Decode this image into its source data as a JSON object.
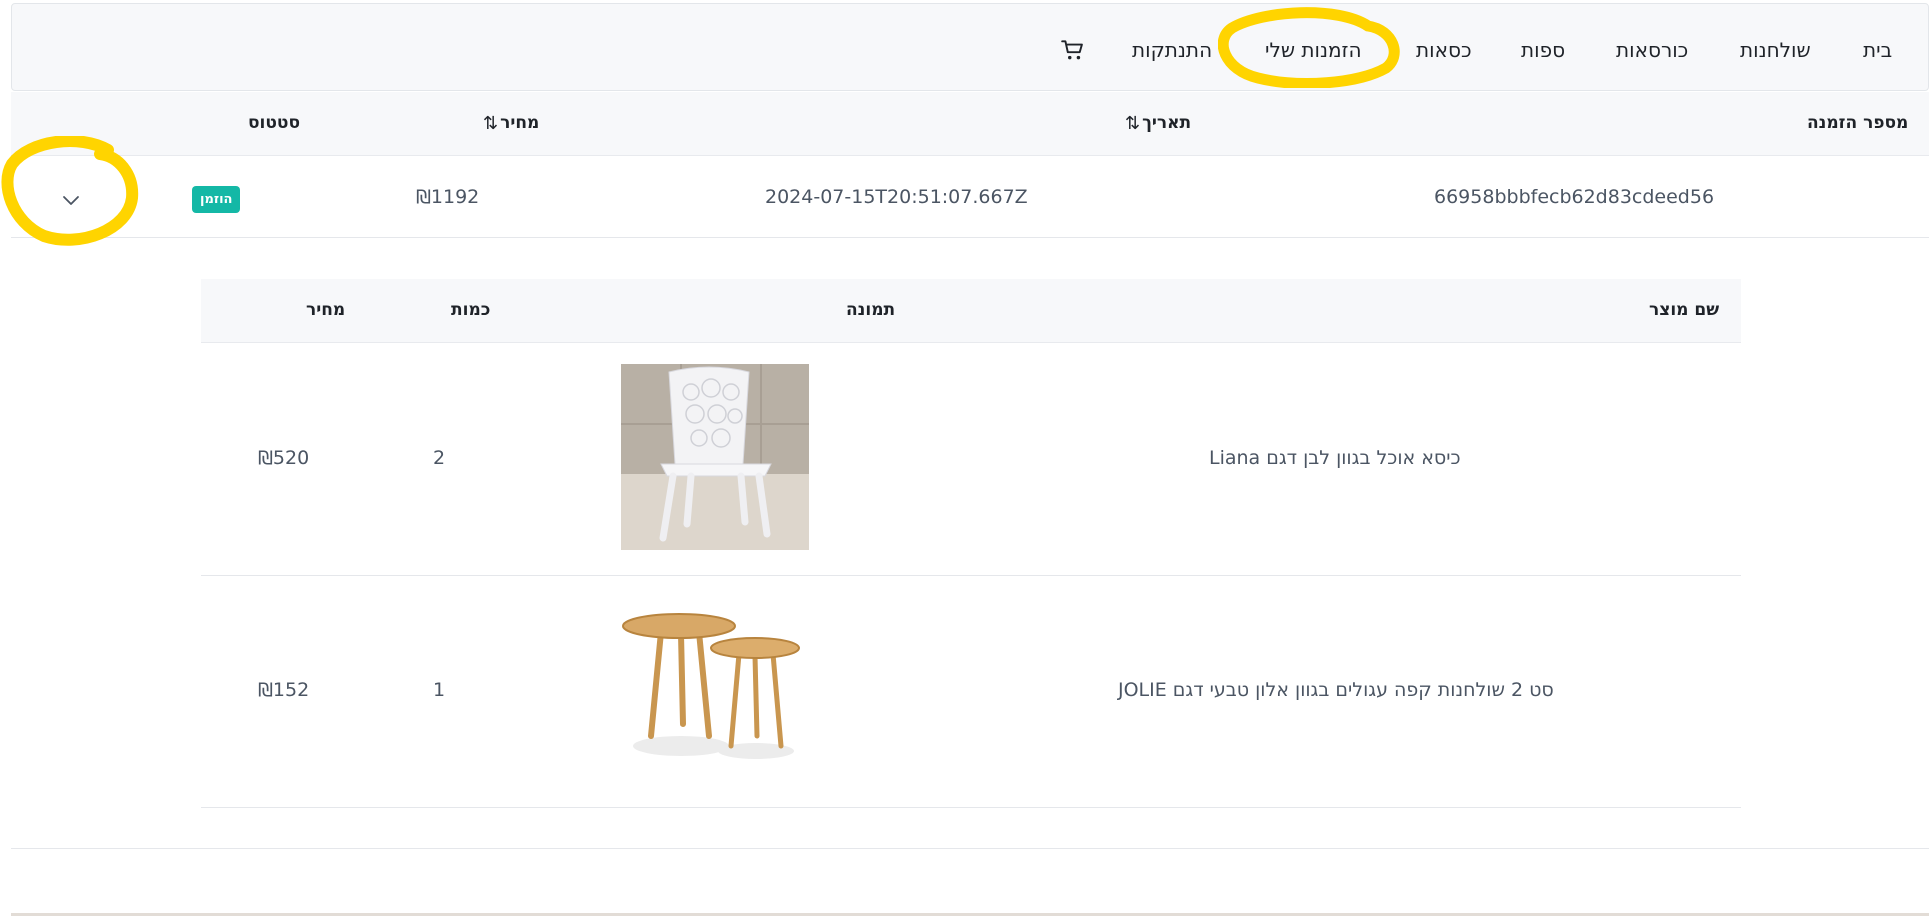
{
  "nav": {
    "items": [
      "בית",
      "שולחנות",
      "כורסאות",
      "ספות",
      "כסאות",
      "הזמנות שלי",
      "התנתקות"
    ],
    "cart_icon": "shopping-cart-icon"
  },
  "orders": {
    "headers": {
      "order_number": "מספר הזמנה",
      "date": "תאריך",
      "price": "מחיר",
      "status": "סטטוס"
    },
    "sort_icon": "⇅",
    "row": {
      "order_number": "66958bbbfecb62d83cdeed56",
      "date": "2024-07-15T20:51:07.667Z",
      "price": "₪1192",
      "status": "הוזמן",
      "status_color": "#14b8a6",
      "expand_icon": "chevron-down-icon"
    }
  },
  "items": {
    "headers": {
      "name": "שם מוצר",
      "image": "תמונה",
      "quantity": "כמות",
      "price": "מחיר"
    },
    "rows": [
      {
        "name": "Liana כיסא אוכל בגוון לבן דגם",
        "quantity": "2",
        "price": "₪520",
        "image": "white-chair-image"
      },
      {
        "name": "JOLIE סט 2 שולחנות קפה עגולים בגוון אלון טבעי דגם",
        "quantity": "1",
        "price": "₪152",
        "image": "coffee-tables-image"
      }
    ]
  },
  "annotation_color": "#ffd400"
}
